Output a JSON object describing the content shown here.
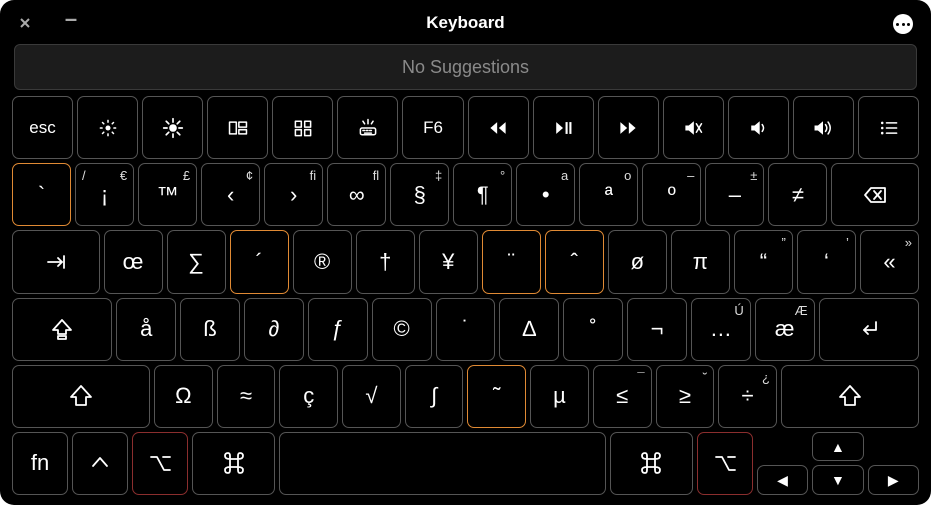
{
  "title": "Keyboard",
  "suggestions_text": "No Suggestions",
  "fn_row": [
    {
      "name": "esc-key",
      "label": "esc",
      "icon": null
    },
    {
      "name": "brightness-down-key",
      "icon": "bright-low"
    },
    {
      "name": "brightness-up-key",
      "icon": "bright-high"
    },
    {
      "name": "mission-control-key",
      "icon": "mission"
    },
    {
      "name": "launchpad-key",
      "icon": "launchpad"
    },
    {
      "name": "keyboard-light-key",
      "icon": "kb-light"
    },
    {
      "name": "f6-key",
      "label": "F6",
      "icon": null
    },
    {
      "name": "rewind-key",
      "icon": "rewind"
    },
    {
      "name": "play-pause-key",
      "icon": "playpause"
    },
    {
      "name": "forward-key",
      "icon": "forward"
    },
    {
      "name": "mute-key",
      "icon": "mute"
    },
    {
      "name": "volume-down-key",
      "icon": "vol-down"
    },
    {
      "name": "volume-up-key",
      "icon": "vol-up"
    },
    {
      "name": "list-key",
      "icon": "list"
    }
  ],
  "row1": [
    {
      "name": "grave-key",
      "label": "`",
      "hl": "orange"
    },
    {
      "name": "1-key",
      "label": "¡",
      "tl": "/",
      "tr": "€"
    },
    {
      "name": "2-key",
      "label": "™",
      "tr": "£"
    },
    {
      "name": "3-key",
      "label": "‹",
      "tr": "¢"
    },
    {
      "name": "4-key",
      "label": "›",
      "tr": "fi"
    },
    {
      "name": "5-key",
      "label": "∞",
      "tr": "fl"
    },
    {
      "name": "6-key",
      "label": "§",
      "tr": "‡"
    },
    {
      "name": "7-key",
      "label": "¶",
      "tr": "°"
    },
    {
      "name": "8-key",
      "label": "•",
      "tr": "a"
    },
    {
      "name": "9-key",
      "label": "ª",
      "tr": "o"
    },
    {
      "name": "0-key",
      "label": "º",
      "tr": "–"
    },
    {
      "name": "minus-key",
      "label": "–",
      "tr": "±"
    },
    {
      "name": "equals-key",
      "label": "≠"
    },
    {
      "name": "backspace-key",
      "icon": "backspace",
      "w": "w-1_5"
    }
  ],
  "row2": [
    {
      "name": "tab-key",
      "icon": "tab",
      "w": "w-1_5"
    },
    {
      "name": "q-key",
      "label": "œ"
    },
    {
      "name": "w-key",
      "label": "∑"
    },
    {
      "name": "e-key",
      "label": "´",
      "hl": "orange"
    },
    {
      "name": "r-key",
      "label": "®"
    },
    {
      "name": "t-key",
      "label": "†"
    },
    {
      "name": "y-key",
      "label": "¥"
    },
    {
      "name": "u-key",
      "label": "¨",
      "hl": "orange"
    },
    {
      "name": "i-key",
      "label": "ˆ",
      "hl": "orange"
    },
    {
      "name": "o-key",
      "label": "ø"
    },
    {
      "name": "p-key",
      "label": "π"
    },
    {
      "name": "bracket-left-key",
      "label": "“",
      "tr": "”"
    },
    {
      "name": "bracket-right-key",
      "label": "‘",
      "tr": "’"
    },
    {
      "name": "backslash-key",
      "label": "«",
      "tr": "»"
    }
  ],
  "row3": [
    {
      "name": "caps-key",
      "icon": "caps",
      "w": "w-1_75"
    },
    {
      "name": "a-key",
      "label": "å"
    },
    {
      "name": "s-key",
      "label": "ß"
    },
    {
      "name": "d-key",
      "label": "∂"
    },
    {
      "name": "f-key",
      "label": "ƒ"
    },
    {
      "name": "g-key",
      "label": "©"
    },
    {
      "name": "h-key",
      "label": "˙"
    },
    {
      "name": "j-key",
      "label": "∆"
    },
    {
      "name": "k-key",
      "label": "˚"
    },
    {
      "name": "l-key",
      "label": "¬"
    },
    {
      "name": "semicolon-key",
      "label": "…",
      "tr": "Ú"
    },
    {
      "name": "quote-key",
      "label": "æ",
      "tr": "Æ"
    },
    {
      "name": "return-key",
      "icon": "return",
      "w": "w-1_75"
    }
  ],
  "row4": [
    {
      "name": "shift-left-key",
      "icon": "shift",
      "w": "w-2_5"
    },
    {
      "name": "z-key",
      "label": "Ω"
    },
    {
      "name": "x-key",
      "label": "≈"
    },
    {
      "name": "c-key",
      "label": "ç"
    },
    {
      "name": "v-key",
      "label": "√"
    },
    {
      "name": "b-key",
      "label": "∫"
    },
    {
      "name": "n-key",
      "label": "˜",
      "hl": "orange"
    },
    {
      "name": "m-key",
      "label": "µ"
    },
    {
      "name": "comma-key",
      "label": "≤",
      "tr": "¯"
    },
    {
      "name": "period-key",
      "label": "≥",
      "tr": "˘"
    },
    {
      "name": "slash-key",
      "label": "÷",
      "tr": "¿"
    },
    {
      "name": "shift-right-key",
      "icon": "shift",
      "w": "w-2_5"
    }
  ],
  "row5": [
    {
      "name": "fn-key",
      "label": "fn"
    },
    {
      "name": "control-key",
      "icon": "control"
    },
    {
      "name": "option-left-key",
      "icon": "option",
      "hl": "red"
    },
    {
      "name": "command-left-key",
      "icon": "command",
      "w": "w-1_5"
    },
    {
      "name": "space-key",
      "label": "",
      "w": "space"
    },
    {
      "name": "command-right-key",
      "icon": "command",
      "w": "w-1_5"
    },
    {
      "name": "option-right-key",
      "icon": "option",
      "hl": "red"
    }
  ],
  "arrows": {
    "up": "▲",
    "down": "▼",
    "left": "◀",
    "right": "▶"
  }
}
